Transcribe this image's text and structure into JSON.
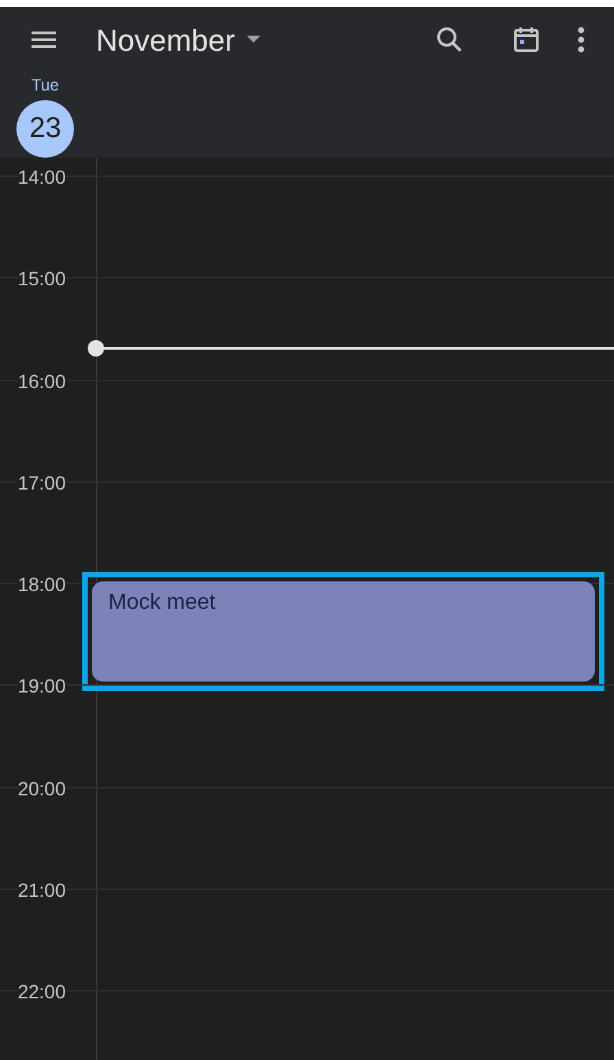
{
  "header": {
    "title": "November"
  },
  "day": {
    "weekday": "Tue",
    "date": "23",
    "selected": true
  },
  "hours": [
    {
      "label": "14:00"
    },
    {
      "label": "15:00",
      "now_line": true
    },
    {
      "label": "16:00"
    },
    {
      "label": "17:00"
    },
    {
      "label": "18:00",
      "events": [
        {
          "title": "Mock meet",
          "color": "#7b83b9",
          "highlighted": true
        }
      ]
    },
    {
      "label": "19:00"
    },
    {
      "label": "20:00"
    },
    {
      "label": "21:00"
    },
    {
      "label": "22:00"
    }
  ]
}
